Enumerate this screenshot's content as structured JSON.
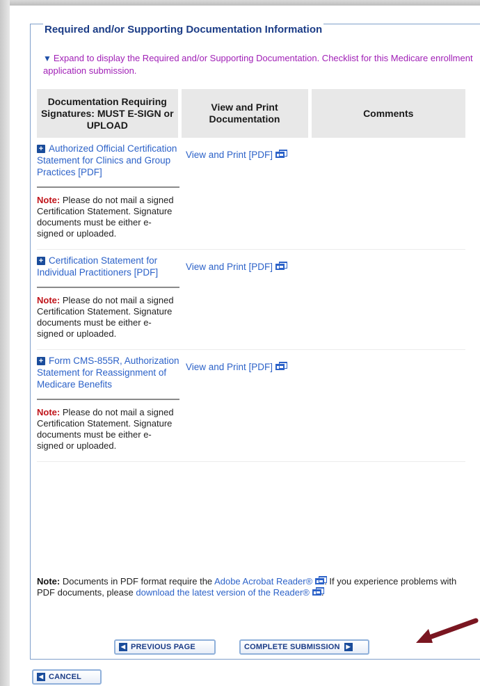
{
  "section": {
    "title": "Required and/or Supporting Documentation Information",
    "expand_text": "Expand to display the Required and/or Supporting Documentation. Checklist for this Medicare enrollment application submission."
  },
  "table": {
    "headers": [
      "Documentation Requiring Signatures: MUST E-SIGN or UPLOAD",
      "View and Print Documentation",
      "Comments"
    ],
    "rows": [
      {
        "doc": "Authorized Official Certification Statement for Clinics and Group Practices [PDF]",
        "view": "View and Print [PDF]",
        "note_label": "Note:",
        "note": "Please do not mail a signed Certification Statement. Signature documents must be either e-signed or uploaded.",
        "comment": ""
      },
      {
        "doc": "Certification Statement for Individual Practitioners [PDF]",
        "view": "View and Print [PDF]",
        "note_label": "Note:",
        "note": "Please do not mail a signed Certification Statement. Signature documents must be either e-signed or uploaded.",
        "comment": ""
      },
      {
        "doc": "Form CMS-855R, Authorization Statement for Reassignment of Medicare Benefits",
        "view": "View and Print [PDF]",
        "note_label": "Note:",
        "note": "Please do not mail a signed Certification Statement. Signature documents must be either e-signed or uploaded.",
        "comment": ""
      }
    ]
  },
  "footnote": {
    "label": "Note:",
    "text1": "Documents in PDF format require the",
    "link1": "Adobe Acrobat Reader®",
    "text2": ". If you experience problems with PDF documents, please",
    "link2": "download the latest version of the Reader®",
    "text3": "."
  },
  "buttons": {
    "previous": "PREVIOUS PAGE",
    "complete": "COMPLETE SUBMISSION",
    "cancel": "CANCEL"
  },
  "colors": {
    "link": "#2c62c8",
    "title": "#1b3c86",
    "expand": "#a01fb6",
    "note_label": "#c0141a",
    "arrow": "#7a1621"
  },
  "icons": {
    "expand": "triangle-down-icon",
    "row_toggle": "plus-square-icon",
    "external": "new-window-icon",
    "back": "back-arrow-icon",
    "forward": "forward-arrow-icon",
    "cancel": "cancel-icon",
    "annotation": "red-arrow-icon"
  }
}
